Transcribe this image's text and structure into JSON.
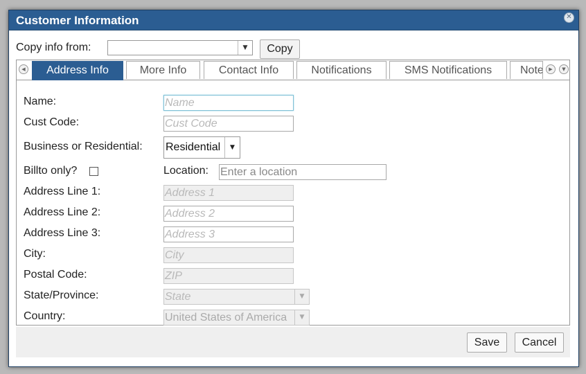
{
  "dialog": {
    "title": "Customer Information",
    "close_icon": "close-icon"
  },
  "copy": {
    "label": "Copy info from:",
    "selected": "",
    "button": "Copy"
  },
  "tabs": [
    {
      "label": "Address Info",
      "active": true
    },
    {
      "label": "More Info",
      "active": false
    },
    {
      "label": "Contact Info",
      "active": false
    },
    {
      "label": "Notifications",
      "active": false
    },
    {
      "label": "SMS Notifications",
      "active": false
    },
    {
      "label": "Notes",
      "active": false
    }
  ],
  "form": {
    "name": {
      "label": "Name:",
      "placeholder": "Name"
    },
    "cust_code": {
      "label": "Cust Code:",
      "placeholder": "Cust Code"
    },
    "business": {
      "label": "Business or Residential:",
      "value": "Residential"
    },
    "billto": {
      "label": "Billto only?",
      "checked": false
    },
    "location": {
      "label": "Location:",
      "placeholder": "Enter a location"
    },
    "address1": {
      "label": "Address Line 1:",
      "placeholder": "Address 1"
    },
    "address2": {
      "label": "Address Line 2:",
      "placeholder": "Address 2"
    },
    "address3": {
      "label": "Address Line 3:",
      "placeholder": "Address 3"
    },
    "city": {
      "label": "City:",
      "placeholder": "City"
    },
    "postal": {
      "label": "Postal Code:",
      "placeholder": "ZIP"
    },
    "state": {
      "label": "State/Province:",
      "placeholder": "State"
    },
    "country": {
      "label": "Country:",
      "value": "United States of America"
    }
  },
  "footer": {
    "save": "Save",
    "cancel": "Cancel"
  },
  "colors": {
    "titlebar": "#2b5d92",
    "active_tab": "#2b5d92"
  }
}
